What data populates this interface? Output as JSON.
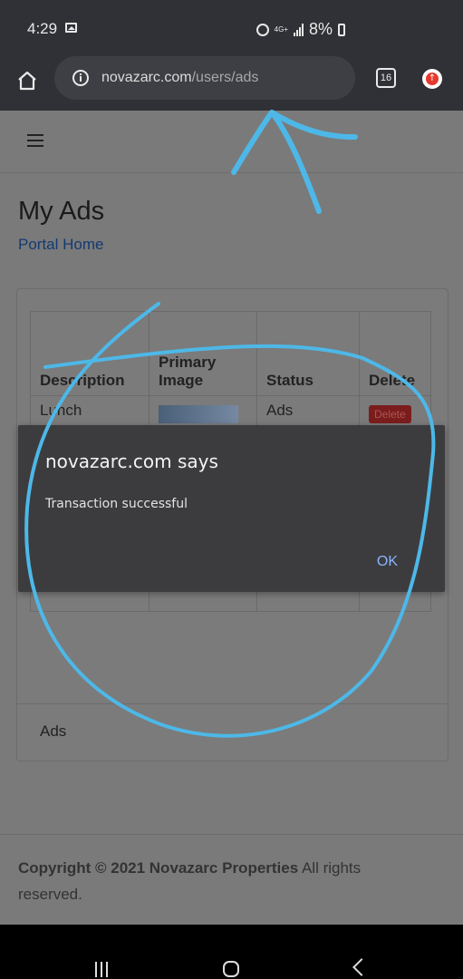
{
  "status_bar": {
    "time": "4:29",
    "network": "4G+",
    "battery": "8%"
  },
  "browser": {
    "url_domain": "novazarc.com",
    "url_path": "/users/ads",
    "tab_count": "16"
  },
  "page": {
    "title": "My Ads",
    "portal_link": "Portal Home",
    "table": {
      "headers": [
        "Description",
        "Primary Image",
        "Status",
        "Delete"
      ],
      "rows": [
        {
          "description": "Lunch",
          "status": "Ads",
          "delete_label": "Delete"
        }
      ]
    },
    "card_footer": "Ads",
    "footer": {
      "copyright_bold": "Copyright © 2021 Novazarc Properties",
      "copyright_rest": " All rights reserved."
    }
  },
  "dialog": {
    "title": "novazarc.com says",
    "message": "Transaction successful",
    "ok_label": "OK"
  },
  "colors": {
    "annotation": "#4db8e8",
    "link": "#143a72",
    "dialog_button": "#8ab4f8"
  }
}
